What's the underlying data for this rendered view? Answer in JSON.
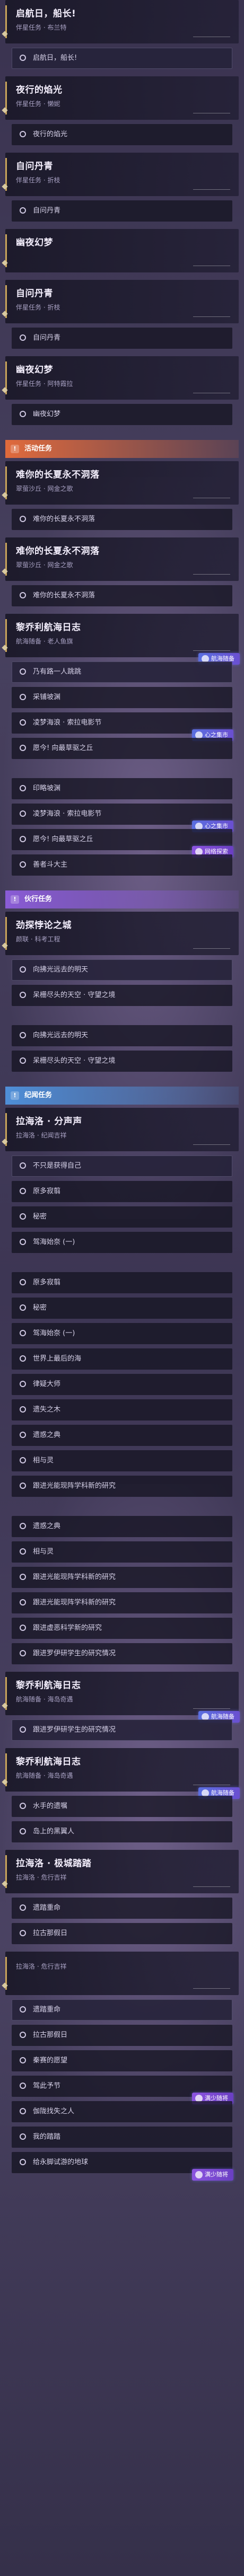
{
  "colors": {
    "accent_gold": "#c9a45a",
    "mission_orange": "#e06a3c",
    "companion_purple": "#8a5cd6",
    "trailblaze_blue": "#4f8fd8",
    "badge_blue": "#5a6fe0"
  },
  "sections": [
    {
      "type": "quest",
      "title": "启航日，船长!",
      "subtitle": "伴星任务 · 布兰特",
      "objectives": [
        {
          "text": "启航日，船长!"
        }
      ]
    },
    {
      "type": "quest",
      "title": "夜行的焰光",
      "subtitle": "伴星任务 · 懒妮",
      "objectives": [
        {
          "text": "夜行的焰光"
        }
      ]
    },
    {
      "type": "quest",
      "title": "自问丹青",
      "subtitle": "伴星任务 · 折枝",
      "objectives": [
        {
          "text": "自问丹青"
        }
      ]
    },
    {
      "type": "quest",
      "title": "幽夜幻梦",
      "subtitle": "",
      "objectives": []
    },
    {
      "type": "quest",
      "title": "自问丹青",
      "subtitle": "伴星任务 · 折枝",
      "objectives": [
        {
          "text": "自问丹青"
        }
      ]
    },
    {
      "type": "quest",
      "title": "幽夜幻梦",
      "subtitle": "伴星任务 · 阿特霞拉",
      "objectives": [
        {
          "text": "幽夜幻梦"
        }
      ]
    },
    {
      "type": "band",
      "variant": "orange",
      "label": "活动任务",
      "icon": "activity-icon"
    },
    {
      "type": "quest",
      "title": "难你的长夏永不洞落",
      "subtitle": "翠萤沙丘 · 网金之歌",
      "objectives": [
        {
          "text": "难你的长夏永不洞落"
        }
      ]
    },
    {
      "type": "quest",
      "title": "难你的长夏永不洞落",
      "subtitle": "翠萤沙丘 · 网金之歌",
      "objectives": [
        {
          "text": "难你的长夏永不洞落"
        }
      ]
    },
    {
      "type": "quest",
      "title": "黎乔利航海日志",
      "subtitle": "航海随备 · 老人鱼旗",
      "tag": "航海随备",
      "objectives": [
        {
          "text": "乃有路一人跳跳"
        },
        {
          "text": "采铺坡渊"
        },
        {
          "text": "凌梦海浪 · 索拉电影节",
          "tag": "心之集市"
        },
        {
          "text": "愿今! 向最草驱之丘"
        }
      ]
    },
    {
      "type": "quest",
      "title": "",
      "subtitle": "",
      "objectives": [
        {
          "text": "印略坡渊"
        },
        {
          "text": "凌梦海浪 · 索拉电影节",
          "tag": "心之集市"
        },
        {
          "text": "愿今! 向最草驱之丘",
          "tag": "网络探索"
        },
        {
          "text": "善者斗大主"
        }
      ]
    },
    {
      "type": "band",
      "variant": "purple",
      "label": "伙行任务",
      "icon": "companion-icon"
    },
    {
      "type": "quest",
      "title": "劲探悖论之城",
      "subtitle": "颜联 · 科考工程",
      "objectives": [
        {
          "text": "向拂光远去的明天"
        },
        {
          "text": "呆栅尽头的天空 · 守望之境"
        }
      ]
    },
    {
      "type": "quest",
      "title": "",
      "subtitle": "",
      "objectives": [
        {
          "text": "向拂光远去的明天"
        },
        {
          "text": "呆栅尽头的天空 · 守望之境"
        }
      ]
    },
    {
      "type": "band",
      "variant": "blue",
      "label": "纪闻任务",
      "icon": "chronicle-icon"
    },
    {
      "type": "quest",
      "title": "拉海洛 · 分声声",
      "subtitle": "拉海洛 · 纪闻吉祥",
      "objectives": [
        {
          "text": "不只是获得自己"
        },
        {
          "text": "原多寂翦"
        },
        {
          "text": "秘密"
        },
        {
          "text": "驾海始奈 (一)"
        }
      ]
    },
    {
      "type": "quest",
      "title": "",
      "subtitle": "",
      "objectives": [
        {
          "text": "原多寂翦"
        },
        {
          "text": "秘密"
        },
        {
          "text": "驾海始奈 (一)"
        },
        {
          "text": "世界上最后的海"
        },
        {
          "text": "律疑大师"
        },
        {
          "text": "遗失之木"
        },
        {
          "text": "遗惑之典"
        },
        {
          "text": "相与灵"
        },
        {
          "text": "跟进光能现阵学科新的研究"
        }
      ]
    },
    {
      "type": "quest",
      "title": "",
      "subtitle": "",
      "objectives": [
        {
          "text": "遗惑之典"
        },
        {
          "text": "相与灵"
        },
        {
          "text": "跟进光能现阵学科新的研究"
        },
        {
          "text": "跟进光能现阵学科新的研究"
        },
        {
          "text": "跟进虚恶科学新的研究"
        },
        {
          "text": "跟进罗伊研学生的研究情况"
        }
      ]
    },
    {
      "type": "quest",
      "title": "黎乔利航海日志",
      "subtitle": "航海随备 · 海岛奇遇",
      "tag": "航海随备",
      "objectives": [
        {
          "text": "跟进罗伊研学生的研究情况"
        }
      ]
    },
    {
      "type": "quest",
      "title": "黎乔利航海日志",
      "subtitle": "航海随备 · 海岛奇遇",
      "tag": "航海随备",
      "objectives": [
        {
          "text": "水手的遗嘱"
        },
        {
          "text": "岛上的黑翼人"
        }
      ]
    },
    {
      "type": "quest",
      "title": "拉海洛 · 极城踏踏",
      "subtitle": "拉海洛 · 危行吉祥",
      "objectives": [
        {
          "text": "遗踏重命"
        },
        {
          "text": "拉古那假日"
        }
      ]
    },
    {
      "type": "quest",
      "title": "",
      "subtitle": "拉海洛 · 危行吉祥",
      "objectives": [
        {
          "text": "遗踏重命"
        },
        {
          "text": "拉古那假日"
        },
        {
          "text": "秦赛的愿望"
        },
        {
          "text": "驾此予节",
          "tag": "满少随将"
        },
        {
          "text": "伽陇找失之人"
        },
        {
          "text": "我的踏踏"
        },
        {
          "text": "给永脚试游的地球",
          "tag": "满少随将"
        }
      ]
    }
  ]
}
